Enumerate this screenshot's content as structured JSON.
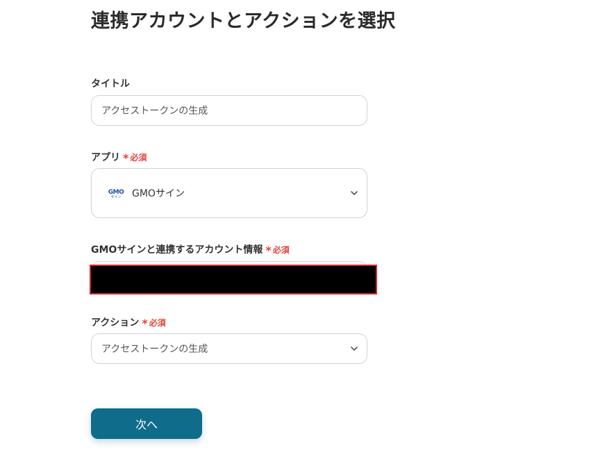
{
  "page": {
    "title": "連携アカウントとアクションを選択"
  },
  "required_label": "必須",
  "fields": {
    "title": {
      "label": "タイトル",
      "value": "アクセストークンの生成"
    },
    "app": {
      "label": "アプリ",
      "value": "GMOサイン",
      "logo_text": "GMO",
      "logo_subtext": "サイン"
    },
    "account": {
      "label": "GMOサインと連携するアカウント情報"
    },
    "action": {
      "label": "アクション",
      "value": "アクセストークンの生成"
    }
  },
  "buttons": {
    "next": "次へ"
  },
  "colors": {
    "accent": "#0f6c8a",
    "required": "#e0453a",
    "redaction_border": "#d8262a",
    "input_border": "#cfd4d9"
  }
}
